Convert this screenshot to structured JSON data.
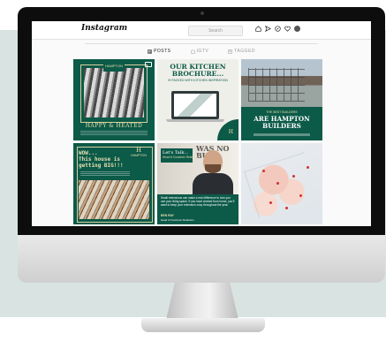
{
  "app": {
    "name": "Instagram",
    "search_placeholder": "Search"
  },
  "tabs": [
    {
      "label": "POSTS",
      "active": true
    },
    {
      "label": "IGTV",
      "active": false
    },
    {
      "label": "TAGGED",
      "active": false
    }
  ],
  "posts": [
    {
      "kind": "image-post",
      "brand": "HAMPTON",
      "caption": "HAPPY & HEATED",
      "has_video_icon": true
    },
    {
      "kind": "image-post",
      "title_line1": "OUR KITCHEN",
      "title_line2": "BROCHURE...",
      "subtitle": "IS PACKED WITH KITCHEN INSPIRATION",
      "brand_mark": "H"
    },
    {
      "kind": "image-post",
      "subtitle": "THE BEST BUILDERS",
      "title_line1": "ARE HAMPTON",
      "title_line2": "BUILDERS",
      "brand": "HAMPTON"
    },
    {
      "kind": "image-post",
      "headline_line1": "WOW...",
      "headline_line2": "This house is",
      "headline_line3": "getting BIG!!!",
      "brand": "HAMPTON",
      "brand_mark": "H"
    },
    {
      "kind": "image-post",
      "heading": "Let's Talk...",
      "role": "Head of Customer Relations",
      "wall_text": "WAS NO BUI",
      "body": "Small extensions can make a real difference to how you use your living space. If you have worked from home, you'll want to keep your extension cosy throughout the year.",
      "name": "BEN RAY",
      "name_role": "Head of Customer Relations"
    },
    {
      "kind": "image-post",
      "map": true
    }
  ],
  "colors": {
    "brand_green": "#0c5a48",
    "brand_gold": "#e8dfb0",
    "backdrop": "#d9e3e2"
  }
}
